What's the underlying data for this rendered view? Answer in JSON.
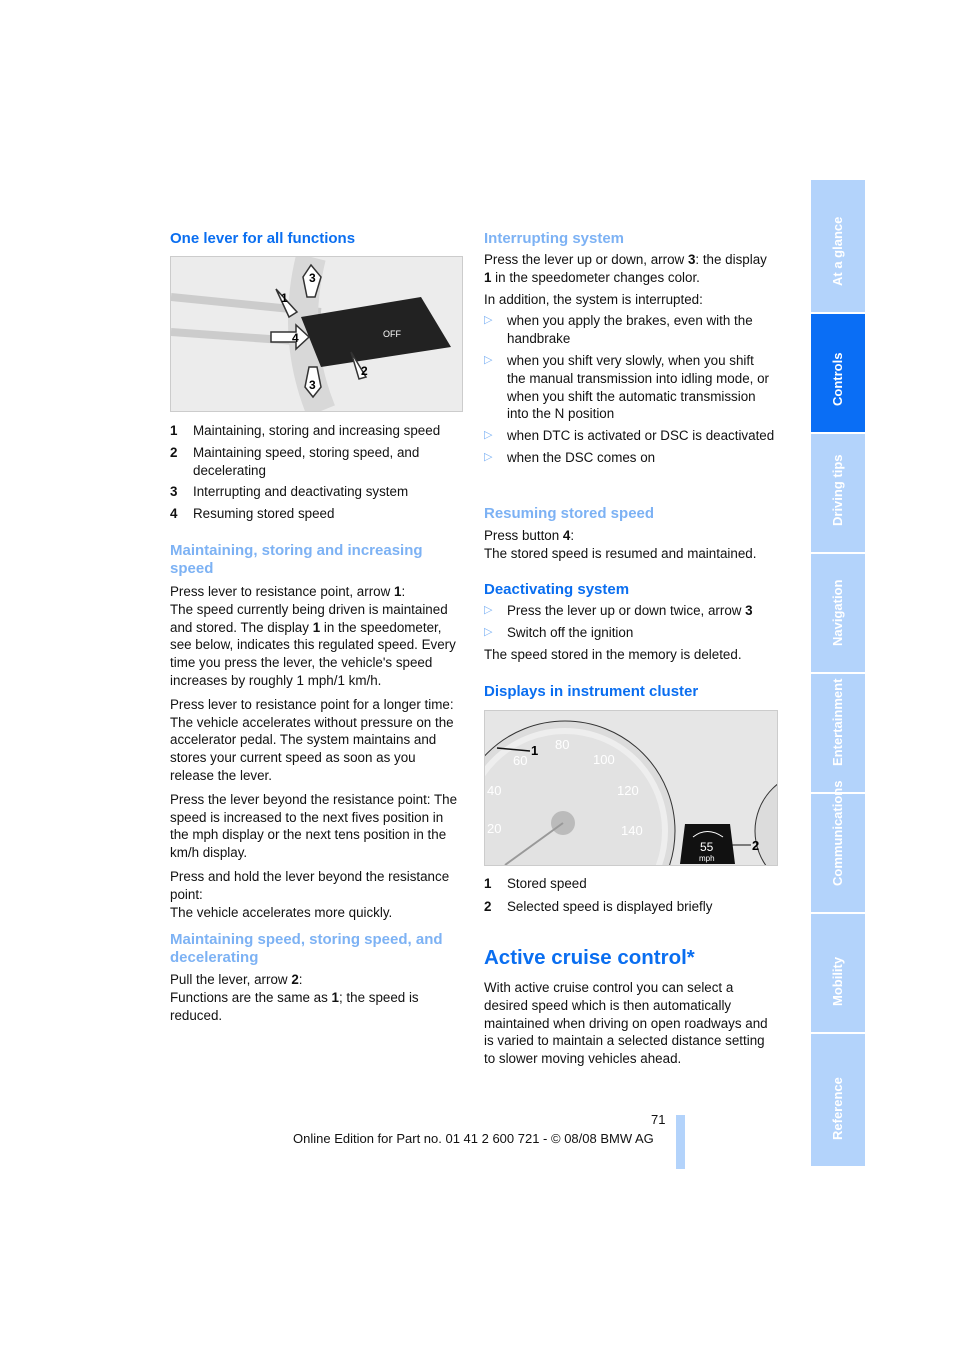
{
  "left": {
    "heading1": "One lever for all functions",
    "figure1": {
      "labels": [
        "1",
        "2",
        "3",
        "3",
        "4"
      ],
      "lever_text": "OFF"
    },
    "legend1": [
      {
        "n": "1",
        "text": "Maintaining, storing and increasing speed"
      },
      {
        "n": "2",
        "text": "Maintaining speed, storing speed, and decelerating"
      },
      {
        "n": "3",
        "text": "Interrupting and deactivating system"
      },
      {
        "n": "4",
        "text": "Resuming stored speed"
      }
    ],
    "heading2": "Maintaining, storing and increasing speed",
    "p1a": "Press lever to resistance point, arrow ",
    "p1b": "1",
    "p1c": ":",
    "p1d": "The speed currently being driven is maintained and stored. The display ",
    "p1e": "1",
    "p1f": " in the speedometer, see below, indicates this regulated speed. Every time you press the lever, the vehicle's speed increases by roughly 1 mph/1 km/h.",
    "p2": "Press lever to resistance point for a longer time: The vehicle accelerates without pressure on the accelerator pedal. The system maintains and stores your current speed as soon as you release the lever.",
    "p3": "Press the lever beyond the resistance point: The speed is increased to the next fives position in the mph display or the next tens position in the km/h display.",
    "p4": "Press and hold the lever beyond the resistance point:",
    "p4b": "The vehicle accelerates more quickly.",
    "heading3": "Maintaining speed, storing speed, and decelerating",
    "p5a": "Pull the lever, arrow ",
    "p5b": "2",
    "p5c": ":",
    "p6a": "Functions are the same as ",
    "p6b": "1",
    "p6c": "; the speed is reduced."
  },
  "right": {
    "heading1": "Interrupting system",
    "p1a": "Press the lever up or down, arrow ",
    "p1b": "3",
    "p1c": ": the display ",
    "p1d": "1",
    "p1e": " in the speedometer changes color.",
    "p2": "In addition, the system is interrupted:",
    "bullets1": [
      "when you apply the brakes, even with the handbrake",
      "when you shift very slowly, when you shift the manual transmission into idling mode, or when you shift the automatic transmission into the N position",
      "when DTC is activated or DSC is deactivated",
      "when the DSC comes on"
    ],
    "heading2": "Resuming stored speed",
    "p3a": "Press button ",
    "p3b": "4",
    "p3c": ":",
    "p3d": "The stored speed is resumed and maintained.",
    "heading3": "Deactivating system",
    "bullets2a": "Press the lever up or down twice, arrow ",
    "bullets2b": "3",
    "bullets2c": "Switch off the ignition",
    "p4": "The speed stored in the memory is deleted.",
    "heading4": "Displays in instrument cluster",
    "figure2": {
      "labels": [
        "1",
        "2"
      ],
      "speed": "55",
      "unit": "mph",
      "dial": [
        "20",
        "40",
        "60",
        "80",
        "100",
        "120",
        "140"
      ]
    },
    "legend2": [
      {
        "n": "1",
        "text": "Stored speed"
      },
      {
        "n": "2",
        "text": "Selected speed is displayed briefly"
      }
    ],
    "heading5": "Active cruise control*",
    "p5": "With active cruise control you can select a desired speed which is then automatically maintained when driving on open roadways and is varied to maintain a selected distance setting to slower moving vehicles ahead."
  },
  "footer": {
    "page": "71",
    "edition": "Online Edition for Part no. 01 41 2 600 721 - © 08/08 BMW AG"
  },
  "tabs": [
    {
      "label": "At a glance",
      "active": false
    },
    {
      "label": "Controls",
      "active": true
    },
    {
      "label": "Driving tips",
      "active": false
    },
    {
      "label": "Navigation",
      "active": false
    },
    {
      "label": "Entertainment",
      "active": false
    },
    {
      "label": "Communications",
      "active": false
    },
    {
      "label": "Mobility",
      "active": false
    },
    {
      "label": "Reference",
      "active": false
    }
  ],
  "colors": {
    "heading_dark": "#0a6ef0",
    "heading_light": "#7db2f4",
    "tab": "#b3d3fb",
    "tab_active": "#0a6ef5"
  }
}
